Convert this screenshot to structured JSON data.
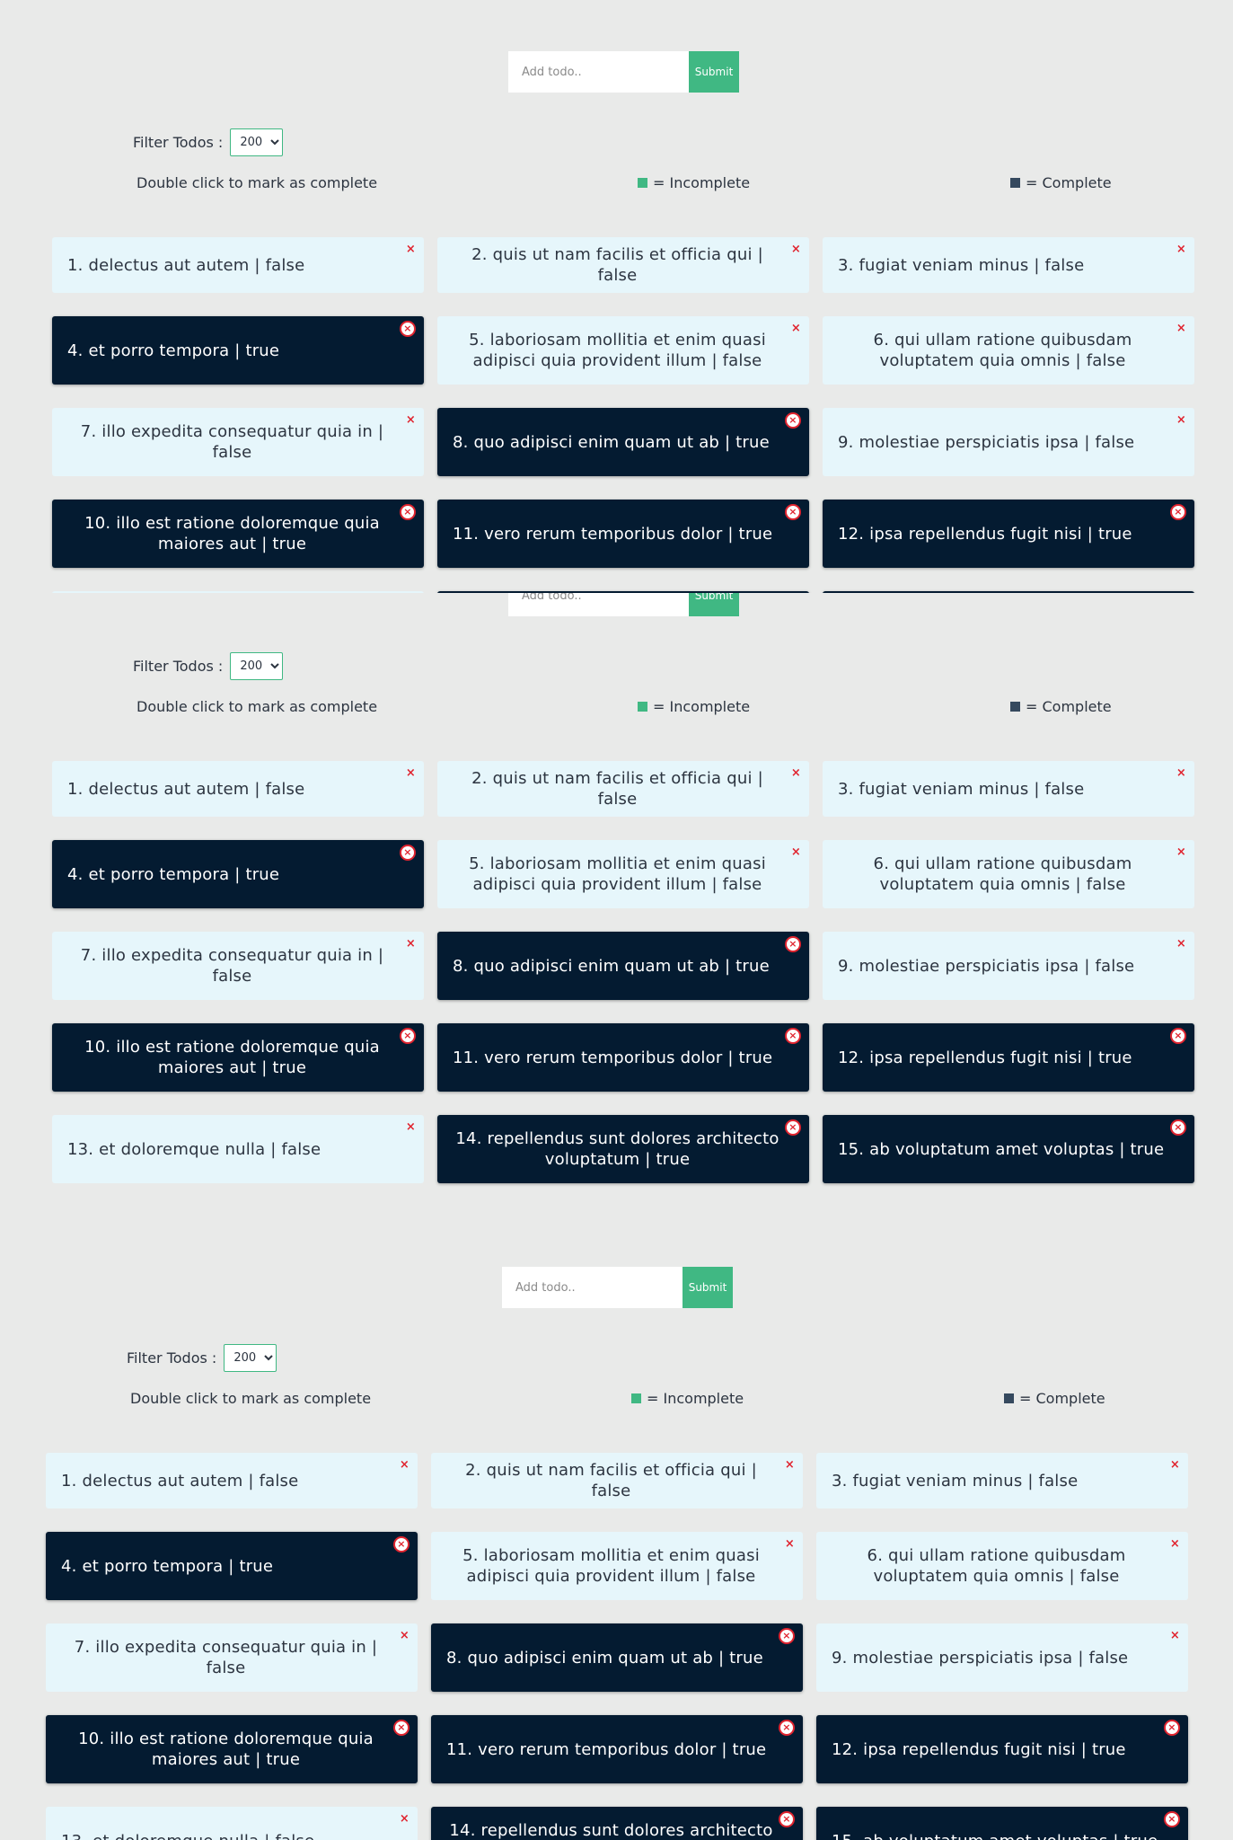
{
  "header": {
    "add_placeholder": "Add todo..",
    "submit_label": "Submit"
  },
  "filter": {
    "label": "Filter Todos :",
    "selected": "200"
  },
  "legend": {
    "hint": "Double click to mark as complete",
    "incomplete_label": "= Incomplete",
    "complete_label": "= Complete",
    "incomplete_color": "#40b883",
    "complete_color": "#35495e"
  },
  "todos": [
    {
      "text": "1. delectus aut autem | false",
      "completed": false
    },
    {
      "text": "2. quis ut nam facilis et officia qui | false",
      "completed": false
    },
    {
      "text": "3. fugiat veniam minus | false",
      "completed": false
    },
    {
      "text": "4. et porro tempora | true",
      "completed": true
    },
    {
      "text": "5. laboriosam mollitia et enim quasi adipisci quia provident illum | false",
      "completed": false
    },
    {
      "text": "6. qui ullam ratione quibusdam voluptatem quia omnis | false",
      "completed": false
    },
    {
      "text": "7. illo expedita consequatur quia in | false",
      "completed": false
    },
    {
      "text": "8. quo adipisci enim quam ut ab | true",
      "completed": true
    },
    {
      "text": "9. molestiae perspiciatis ipsa | false",
      "completed": false
    },
    {
      "text": "10. illo est ratione doloremque quia maiores aut | true",
      "completed": true
    },
    {
      "text": "11. vero rerum temporibus dolor | true",
      "completed": true
    },
    {
      "text": "12. ipsa repellendus fugit nisi | true",
      "completed": true
    },
    {
      "text": "13. et doloremque nulla | false",
      "completed": false
    },
    {
      "text": "14. repellendus sunt dolores architecto voluptatum | true",
      "completed": true
    },
    {
      "text": "15. ab voluptatum amet voluptas | true",
      "completed": true
    }
  ],
  "delete_icon_glyph": "×"
}
